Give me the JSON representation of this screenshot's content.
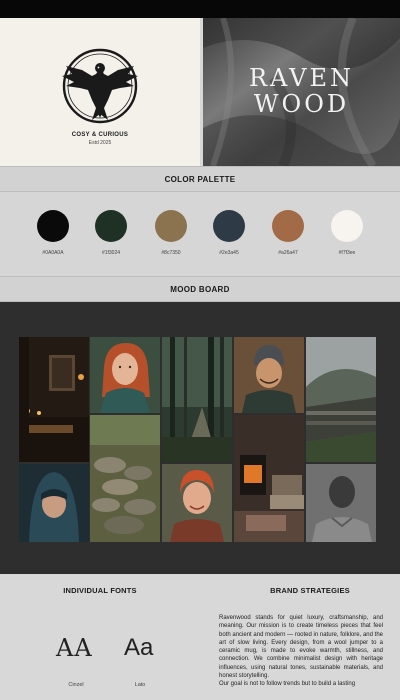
{
  "brand": {
    "tagline": "COSY & CURIOUS",
    "established": "Estd 2025",
    "wordmark_line1": "RAVEN",
    "wordmark_line2": "WOOD"
  },
  "sections": {
    "palette_title": "COLOR PALETTE",
    "mood_title": "MOOD BOARD",
    "fonts_title": "INDIVIDUAL FONTS",
    "strategies_title": "BRAND STRATEGIES"
  },
  "palette": [
    {
      "hex": "#0A0A0A",
      "label": "#0A0A0A"
    },
    {
      "hex": "#1f3024",
      "label": "#1f3024"
    },
    {
      "hex": "#8c7350",
      "label": "#8c7350"
    },
    {
      "hex": "#2e3a45",
      "label": "#2e3a45"
    },
    {
      "hex": "#a26a47",
      "label": "#a26a47"
    },
    {
      "hex": "#f7f3ee",
      "label": "#f7f3ee"
    }
  ],
  "mood_board": [
    {
      "subject": "candle-lit study interior",
      "name": "mood-tile-study"
    },
    {
      "subject": "red-haired woman in green knit scarf",
      "name": "mood-tile-woman-scarf"
    },
    {
      "subject": "misty forest path",
      "name": "mood-tile-forest"
    },
    {
      "subject": "smiling man in grey beanie",
      "name": "mood-tile-man-beanie"
    },
    {
      "subject": "stone wall on misty hill",
      "name": "mood-tile-stone-hill"
    },
    {
      "subject": "mossy stacked stones",
      "name": "mood-tile-stones"
    },
    {
      "subject": "woodstove with blankets",
      "name": "mood-tile-stove"
    },
    {
      "subject": "person in teal hooded cloak",
      "name": "mood-tile-hooded"
    },
    {
      "subject": "red-haired woman smiling",
      "name": "mood-tile-woman-red"
    },
    {
      "subject": "man in cable knit sweater",
      "name": "mood-tile-man-knit"
    }
  ],
  "fonts": [
    {
      "sample": "AA",
      "name": "Cinzel"
    },
    {
      "sample": "Aa",
      "name": "Lato"
    }
  ],
  "strategies": {
    "paragraph1": "Ravenwood stands for quiet luxury, craftsmanship, and meaning. Our mission is to create timeless pieces that feel both ancient and modern — rooted in nature, folklore, and the art of slow living. Every design, from a wool jumper to a ceramic mug, is made to evoke warmth, stillness, and connection. We combine minimalist design with heritage influences, using natural tones, sustainable materials, and honest storytelling.",
    "paragraph2": "Our goal is not to follow trends but to build a lasting"
  }
}
